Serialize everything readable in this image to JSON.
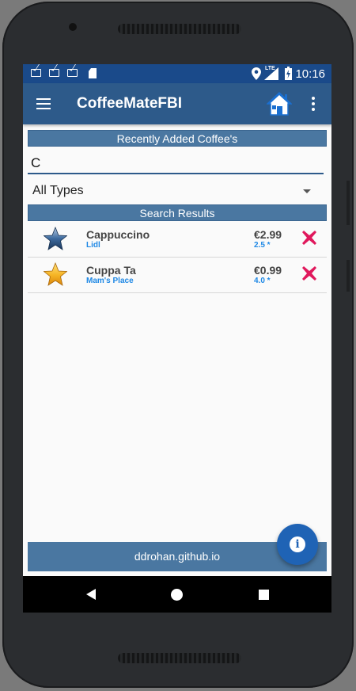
{
  "status_bar": {
    "time": "10:16",
    "network": "LTE"
  },
  "toolbar": {
    "title": "CoffeeMateFBI",
    "menu_icon": "hamburger-menu-icon",
    "home_icon": "home-icon",
    "overflow_icon": "more-vert-icon"
  },
  "recent_header": "Recently Added Coffee's",
  "search": {
    "value": "C"
  },
  "type_filter": {
    "selected": "All Types"
  },
  "results_header": "Search Results",
  "results": [
    {
      "name": "Cappuccino",
      "shop": "Lidl",
      "price": "€2.99",
      "rating": "2.5 *",
      "favourite": false
    },
    {
      "name": "Cuppa Ta",
      "shop": "Mam's Place",
      "price": "€0.99",
      "rating": "4.0 *",
      "favourite": true
    }
  ],
  "footer": {
    "text": "ddrohan.github.io"
  },
  "fab": {
    "icon": "info-icon",
    "glyph": "i"
  },
  "colors": {
    "status_bar": "#1a4a8a",
    "toolbar": "#2d5a8a",
    "section_bar": "#4a77a1",
    "accent_text": "#1e88e5",
    "delete": "#e0185c",
    "fab": "#1f63b5"
  }
}
